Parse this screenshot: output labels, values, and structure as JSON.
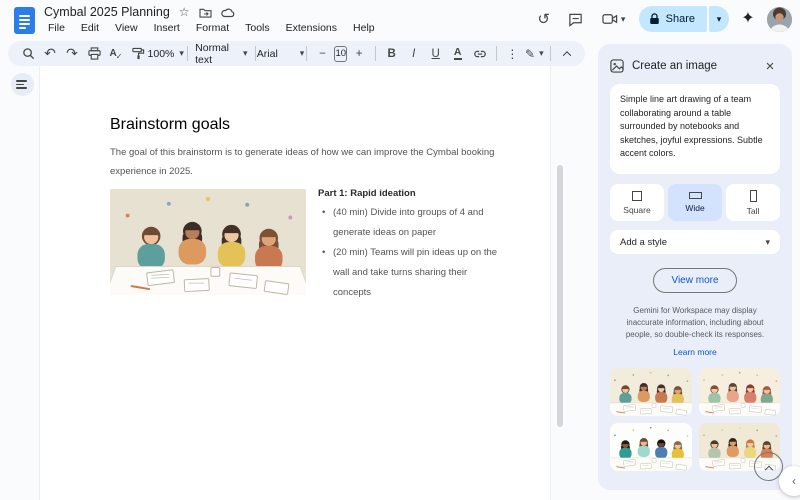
{
  "titlebar": {
    "doc_title": "Cymbal 2025 Planning",
    "menus": [
      "File",
      "Edit",
      "View",
      "Insert",
      "Format",
      "Tools",
      "Extensions",
      "Help"
    ]
  },
  "topbar_actions": {
    "share_label": "Share"
  },
  "toolbar": {
    "zoom_value": "100%",
    "paragraph_style": "Normal text",
    "font_family": "Arial",
    "font_size": "10",
    "bold": "B",
    "italic": "I",
    "underline": "U",
    "text_color": "A",
    "minus": "−",
    "plus": "+",
    "more_dots": "⋮",
    "pen": "✎",
    "undo": "↶",
    "redo": "↷"
  },
  "document": {
    "heading": "Brainstorm goals",
    "intro": "The goal of this brainstorm is to generate ideas of how we can improve the Cymbal booking experience in 2025.",
    "part_title": "Part 1: Rapid ideation",
    "bullets": [
      "(40 min) Divide into groups of 4 and generate ideas on paper",
      "(20 min) Teams will pin ideas up on the wall and take turns sharing their concepts"
    ]
  },
  "sidebar": {
    "title": "Create an image",
    "prompt": "Simple line art drawing of a team collaborating around a table surrounded by notebooks and sketches, joyful expressions. Subtle accent colors.",
    "aspects": [
      {
        "label": "Square",
        "selected": false
      },
      {
        "label": "Wide",
        "selected": true
      },
      {
        "label": "Tall",
        "selected": false
      }
    ],
    "style_placeholder": "Add a style",
    "view_more": "View more",
    "disclaimer": "Gemini for Workspace may display inaccurate information, including about people, so double-check its responses.",
    "learn_more": "Learn more",
    "selected_color": "#d3e3fd",
    "link_color": "#0b57d0"
  },
  "doc_image": {
    "palette": {
      "bg": "#e7e1d2",
      "accents": [
        "#d96f4e",
        "#6d9bd4",
        "#e5bb3f",
        "#67a392",
        "#c98bb8"
      ],
      "people": [
        {
          "shirt": "#5d9f9c",
          "hair": "#6f4a33",
          "skin": "#eec19b",
          "long": false
        },
        {
          "shirt": "#dc9a5e",
          "hair": "#3c2d28",
          "skin": "#b97e55",
          "long": true
        },
        {
          "shirt": "#e3c257",
          "hair": "#433027",
          "skin": "#eec8a2",
          "long": true
        },
        {
          "shirt": "#c8794f",
          "hair": "#7b5137",
          "skin": "#dda577",
          "long": true
        }
      ]
    }
  },
  "thumbnails": [
    {
      "name": "generated-image-1",
      "palette": {
        "bg": "#f2ecdd",
        "accents": [
          "#d96f4e",
          "#6d9bd4",
          "#e5bb3f",
          "#67a392",
          "#c98bb8"
        ],
        "people": [
          {
            "shirt": "#5d9f9c",
            "hair": "#6f4a33",
            "skin": "#eec19b",
            "long": false
          },
          {
            "shirt": "#dc9a5e",
            "hair": "#3c2d28",
            "skin": "#b97e55",
            "long": true
          },
          {
            "shirt": "#c8794f",
            "hair": "#433027",
            "skin": "#eec8a2",
            "long": true
          },
          {
            "shirt": "#e3c257",
            "hair": "#7b5137",
            "skin": "#dda577",
            "long": true
          }
        ]
      }
    },
    {
      "name": "generated-image-2",
      "palette": {
        "bg": "#f6efe0",
        "accents": [
          "#a8c3a0",
          "#e8a58b",
          "#d77f6d",
          "#9ec3a8",
          "#c9a86b"
        ],
        "people": [
          {
            "shirt": "#9ec3a8",
            "hair": "#7a513a",
            "skin": "#f0c9a4",
            "long": false
          },
          {
            "shirt": "#e8a58b",
            "hair": "#5d4434",
            "skin": "#eec19b",
            "long": true
          },
          {
            "shirt": "#d77f6d",
            "hair": "#8a3d2f",
            "skin": "#f0c9a4",
            "long": true
          },
          {
            "shirt": "#7fa98f",
            "hair": "#a65a3c",
            "skin": "#eec19b",
            "long": true
          }
        ]
      }
    },
    {
      "name": "generated-image-3",
      "palette": {
        "bg": "#fdfdfc",
        "accents": [
          "#2f9d94",
          "#e7c033",
          "#4a7fb5",
          "#d98f63",
          "#9fd8cd"
        ],
        "people": [
          {
            "shirt": "#2f9d94",
            "hair": "#1f1a17",
            "skin": "#8a5a3b",
            "long": true
          },
          {
            "shirt": "#9fd8cd",
            "hair": "#6b4a33",
            "skin": "#e9b98d",
            "long": true
          },
          {
            "shirt": "#4a7fb5",
            "hair": "#14100e",
            "skin": "#6e452c",
            "long": false
          },
          {
            "shirt": "#e7c033",
            "hair": "#8a6a45",
            "skin": "#ecc39a",
            "long": true
          }
        ]
      }
    },
    {
      "name": "generated-image-4",
      "palette": {
        "bg": "#f0e9d6",
        "accents": [
          "#e09a64",
          "#b5c4ae",
          "#ead77f",
          "#d97f54",
          "#8ba8c9"
        ],
        "people": [
          {
            "shirt": "#b5c4ae",
            "hair": "#4a3a2e",
            "skin": "#eec19b",
            "long": false
          },
          {
            "shirt": "#e09a64",
            "hair": "#33261f",
            "skin": "#d8a06b",
            "long": true
          },
          {
            "shirt": "#ead77f",
            "hair": "#c27b44",
            "skin": "#f0caa4",
            "long": true
          },
          {
            "shirt": "#d97f54",
            "hair": "#5c4330",
            "skin": "#e9b98d",
            "long": true
          }
        ]
      }
    }
  ]
}
